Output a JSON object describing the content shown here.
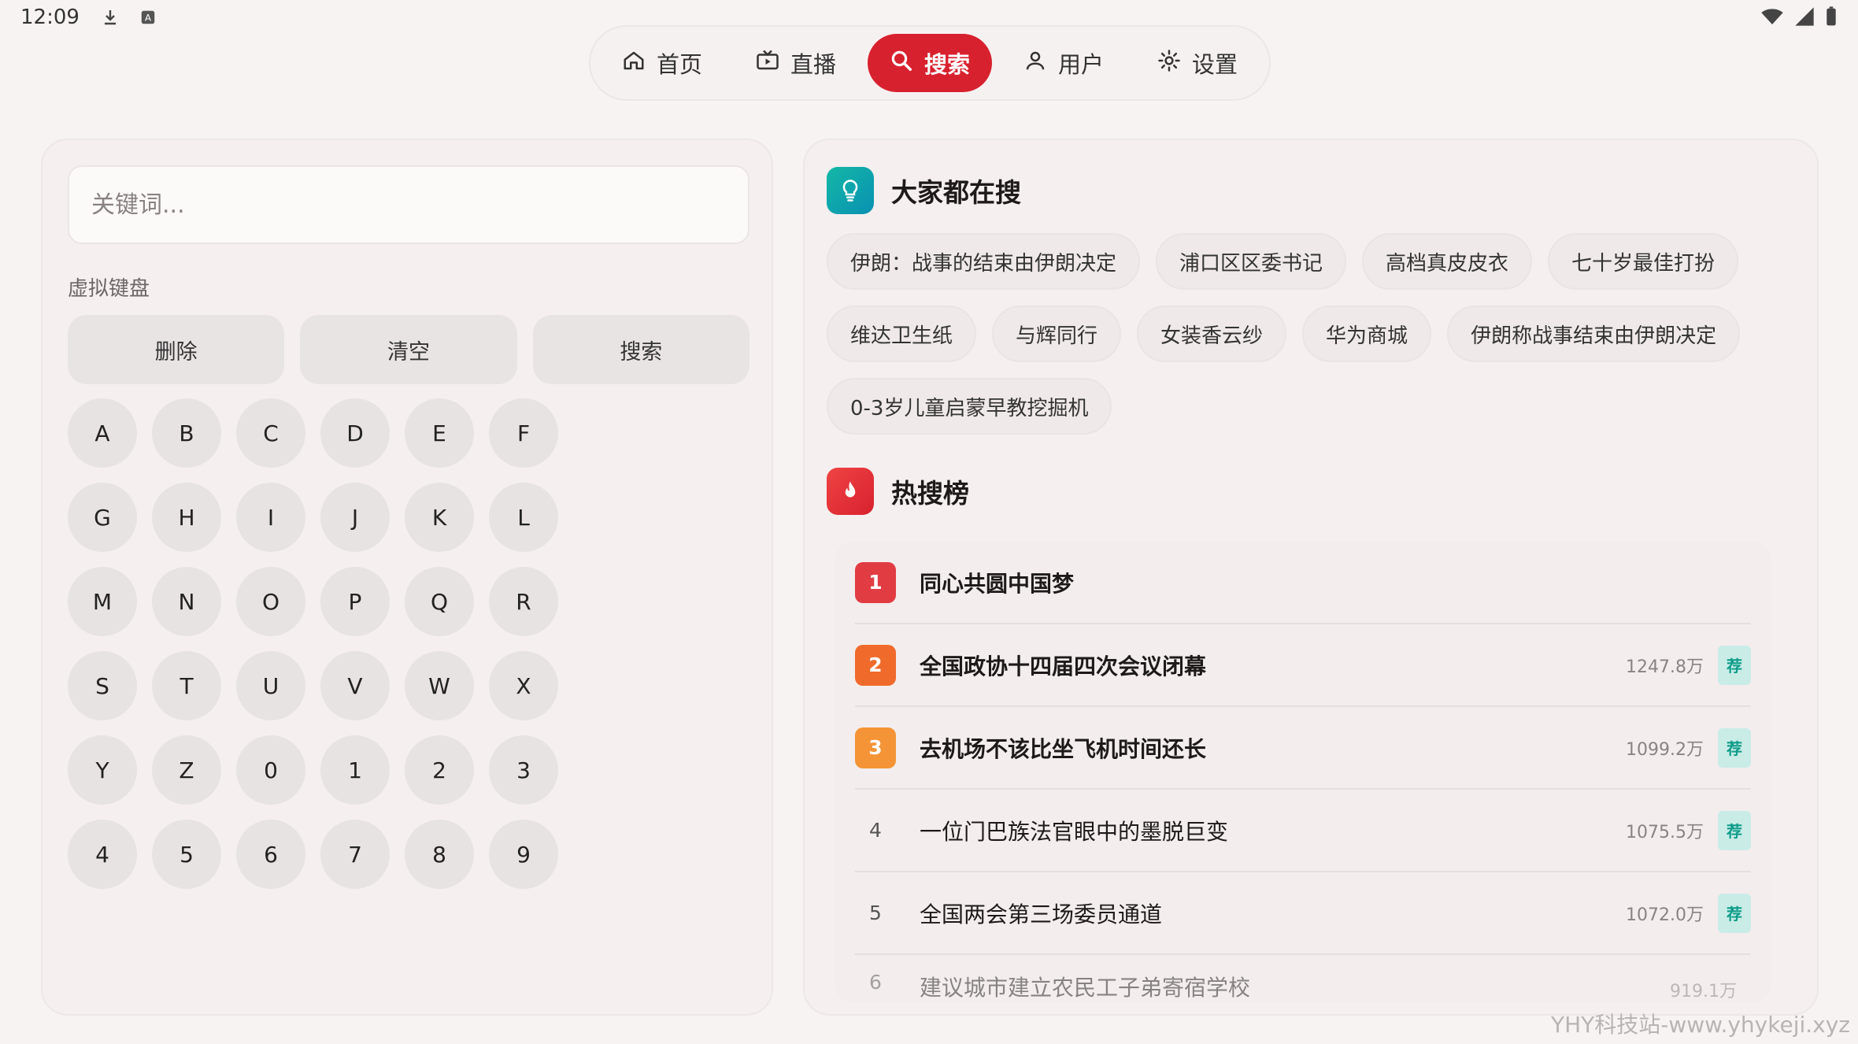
{
  "status_bar": {
    "time": "12:09",
    "icons": [
      "download-icon",
      "a-badge-icon"
    ],
    "right_icons": [
      "wifi-icon",
      "signal-icon",
      "battery-icon"
    ]
  },
  "nav": {
    "tabs": [
      {
        "label": "首页",
        "icon": "home-icon",
        "active": false
      },
      {
        "label": "直播",
        "icon": "tv-icon",
        "active": false
      },
      {
        "label": "搜索",
        "icon": "search-icon",
        "active": true
      },
      {
        "label": "用户",
        "icon": "user-icon",
        "active": false
      },
      {
        "label": "设置",
        "icon": "gear-icon",
        "active": false
      }
    ],
    "accent": "#d8212e"
  },
  "search": {
    "placeholder": "关键词...",
    "value": ""
  },
  "keyboard": {
    "label": "虚拟键盘",
    "actions": [
      "删除",
      "清空",
      "搜索"
    ],
    "keys": [
      "A",
      "B",
      "C",
      "D",
      "E",
      "F",
      "G",
      "H",
      "I",
      "J",
      "K",
      "L",
      "M",
      "N",
      "O",
      "P",
      "Q",
      "R",
      "S",
      "T",
      "U",
      "V",
      "W",
      "X",
      "Y",
      "Z",
      "0",
      "1",
      "2",
      "3",
      "4",
      "5",
      "6",
      "7",
      "8",
      "9"
    ]
  },
  "popular": {
    "title": "大家都在搜",
    "icon": "lightbulb-icon",
    "chips": [
      "伊朗：战事的结束由伊朗决定",
      "浦口区区委书记",
      "高档真皮皮衣",
      "七十岁最佳打扮",
      "维达卫生纸",
      "与辉同行",
      "女装香云纱",
      "华为商城",
      "伊朗称战事结束由伊朗决定",
      "0-3岁儿童启蒙早教挖掘机"
    ]
  },
  "hot": {
    "title": "热搜榜",
    "icon": "fire-icon",
    "items": [
      {
        "rank": "1",
        "title": "同心共圆中国梦",
        "heat": "",
        "badge": ""
      },
      {
        "rank": "2",
        "title": "全国政协十四届四次会议闭幕",
        "heat": "1247.8万",
        "badge": "荐"
      },
      {
        "rank": "3",
        "title": "去机场不该比坐飞机时间还长",
        "heat": "1099.2万",
        "badge": "荐"
      },
      {
        "rank": "4",
        "title": "一位门巴族法官眼中的墨脱巨变",
        "heat": "1075.5万",
        "badge": "荐"
      },
      {
        "rank": "5",
        "title": "全国两会第三场委员通道",
        "heat": "1072.0万",
        "badge": "荐"
      },
      {
        "rank": "6",
        "title": "建议城市建立农民工子弟寄宿学校",
        "heat": "919.1万",
        "badge": ""
      }
    ]
  },
  "watermark": "YHY科技站-www.yhykeji.xyz"
}
